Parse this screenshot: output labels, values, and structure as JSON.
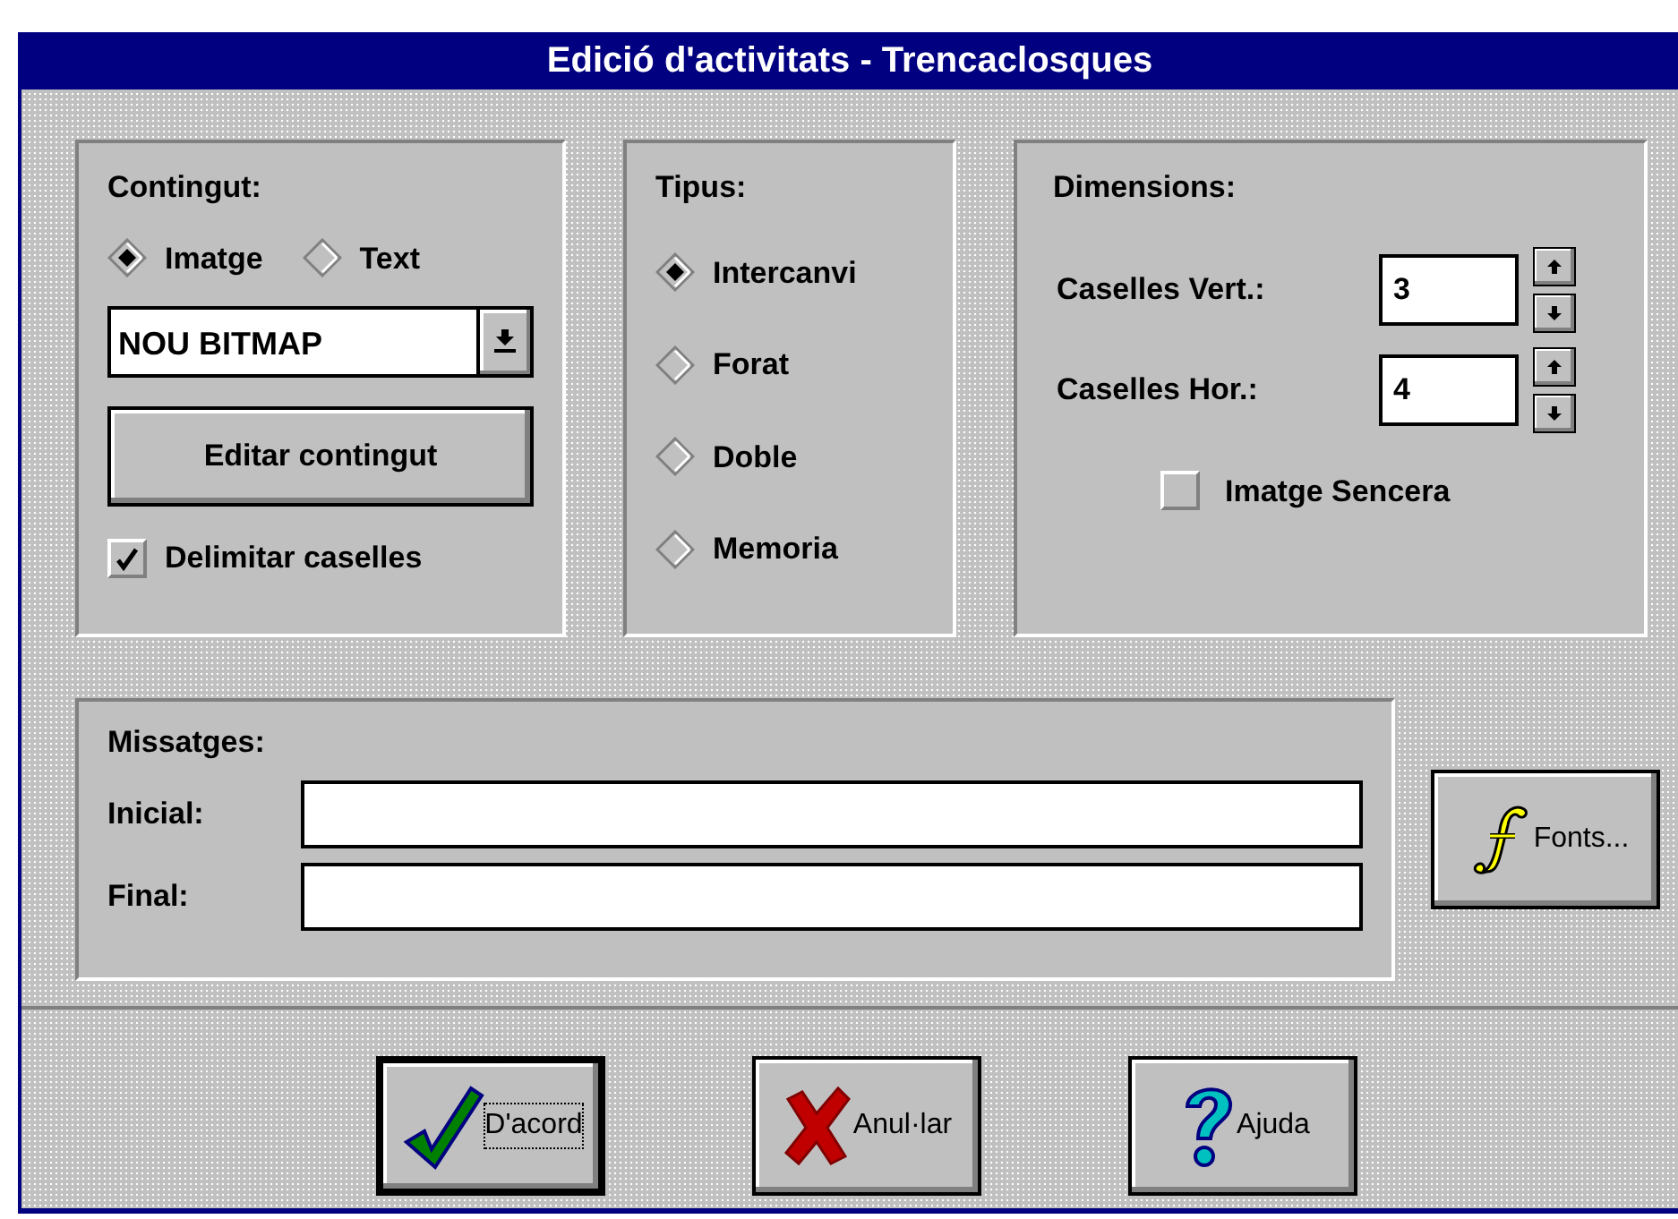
{
  "window": {
    "title": "Edició d'activitats - Trencaclosques"
  },
  "contingut": {
    "label": "Contingut:",
    "options": [
      {
        "label": "Imatge",
        "selected": true
      },
      {
        "label": "Text",
        "selected": false
      }
    ],
    "dropdown": {
      "value": "NOU BITMAP"
    },
    "button": "Editar contingut",
    "checkbox": {
      "label": "Delimitar caselles",
      "checked": true
    }
  },
  "tipus": {
    "label": "Tipus:",
    "options": [
      {
        "label": "Intercanvi",
        "selected": true
      },
      {
        "label": "Forat",
        "selected": false
      },
      {
        "label": "Doble",
        "selected": false
      },
      {
        "label": "Memoria",
        "selected": false
      }
    ]
  },
  "dimensions": {
    "label": "Dimensions:",
    "fields": [
      {
        "label": "Caselles Vert.:",
        "value": "3"
      },
      {
        "label": "Caselles Hor.:",
        "value": "4"
      }
    ],
    "checkbox": {
      "label": "Imatge Sencera",
      "checked": false
    }
  },
  "missatges": {
    "label": "Missatges:",
    "fields": [
      {
        "label": "Inicial:"
      },
      {
        "label": "Final:"
      }
    ]
  },
  "fonts_button": {
    "label": "Fonts..."
  },
  "buttons": [
    {
      "label": "D'acord",
      "kind": "ok",
      "default": true
    },
    {
      "label": "Anul·lar",
      "kind": "cancel",
      "default": false
    },
    {
      "label": "Ajuda",
      "kind": "help",
      "default": false
    }
  ]
}
